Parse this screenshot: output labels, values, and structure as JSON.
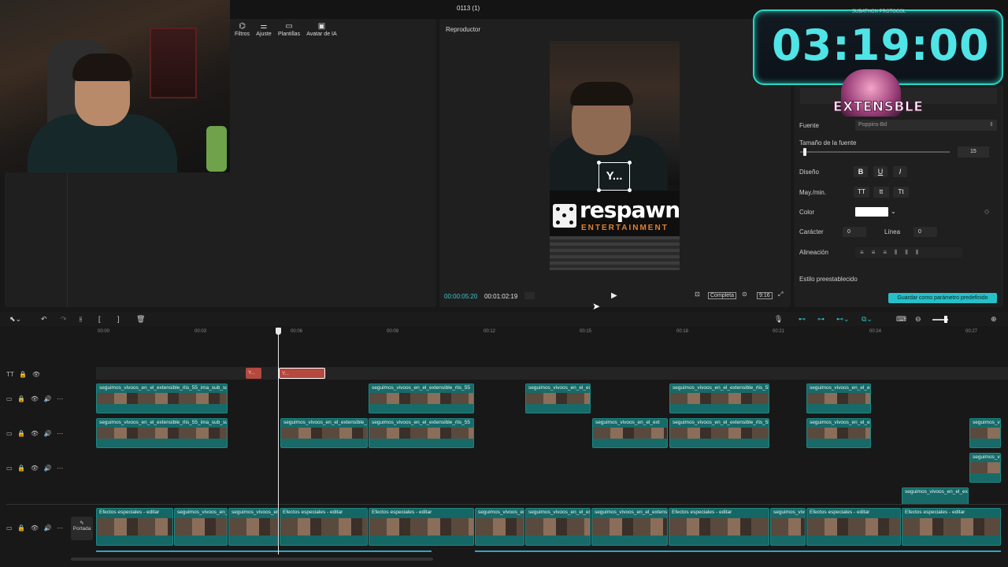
{
  "window": {
    "title": "0113 (1)"
  },
  "toolbar": {
    "items": [
      {
        "icon": "filters-icon",
        "label": "Filtros"
      },
      {
        "icon": "adjust-icon",
        "label": "Ajuste"
      },
      {
        "icon": "templates-icon",
        "label": "Plantillas"
      },
      {
        "icon": "ai-avatar-icon",
        "label": "Avatar de IA"
      }
    ]
  },
  "player": {
    "label": "Reproductor",
    "current_time": "00:00:05:20",
    "total_time": "00:01:02:19",
    "full_label": "Completa",
    "ratio_label": "9:16",
    "overlay_text": "Y...",
    "video_text_main": "respawn",
    "video_text_sub": "ENTERTAINMENT"
  },
  "overlay": {
    "timer": "03:19:00",
    "timer_caption": "SUBATHON PROTOCOL",
    "logo_text": "EXTENSBLE"
  },
  "properties": {
    "font_label": "Fuente",
    "font_value": "Poppins-Bd",
    "size_label": "Tamaño de la fuente",
    "size_value": "15",
    "design_label": "Diseño",
    "design_buttons": [
      "B",
      "U",
      "I"
    ],
    "case_label": "May./min.",
    "case_buttons": [
      "TT",
      "tt",
      "Tt"
    ],
    "color_label": "Color",
    "color_value": "#ffffff",
    "char_label": "Carácter",
    "char_value": "0",
    "line_label": "Línea",
    "line_value": "0",
    "align_label": "Alineación",
    "preset_label": "Estilo preestablecido",
    "save_button": "Guardar como parámetro predefinido"
  },
  "timeline": {
    "ruler": [
      "00:00",
      "00:03",
      "00:06",
      "00:09",
      "00:12",
      "00:15",
      "00:18",
      "00:21",
      "00:24",
      "00:27"
    ],
    "text_clips": [
      "Y...",
      "Y..."
    ],
    "clip_name": "seguimos_vivoos_en_el_extensible_rlis_55_ima_sub_sur",
    "clip_name_short": "seguimos_vivoos_en_el_extensible_rlis_55",
    "clip_name_tiny": "seguimos_vivoos_en_el_ext",
    "fx_label": "Efectos especiales - editar",
    "cover_label": "Portada",
    "accent": "#27c0c8",
    "text_clip_color": "#b5483f",
    "clip_color": "#176a68"
  }
}
